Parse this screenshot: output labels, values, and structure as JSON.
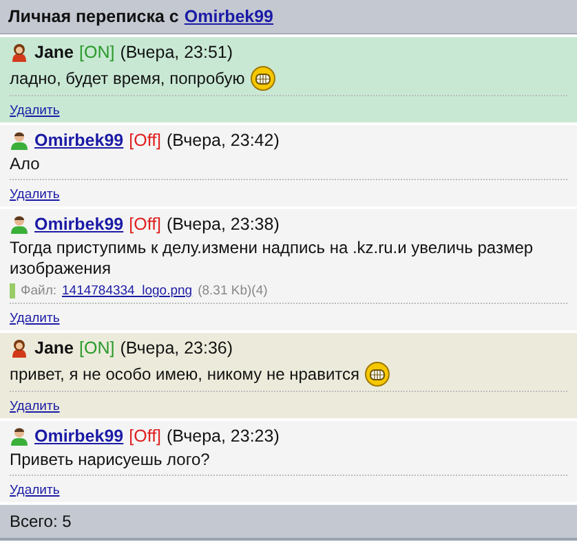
{
  "title": {
    "text": "Личная переписка с",
    "user": "Omirbek99"
  },
  "messages": [
    {
      "author": "Jane",
      "kind": "female",
      "linked": false,
      "online": true,
      "status": "[ON]",
      "time": "(Вчера, 23:51)",
      "text": "ладно, будет время, попробую",
      "smiley": true,
      "color": "#c8e8d4",
      "delete": "Удалить"
    },
    {
      "author": "Omirbek99",
      "kind": "male",
      "linked": true,
      "online": false,
      "status": "[Off]",
      "time": "(Вчера, 23:42)",
      "text": "Ало",
      "smiley": false,
      "color": "#f4f4f4",
      "delete": "Удалить"
    },
    {
      "author": "Omirbek99",
      "kind": "male",
      "linked": true,
      "online": false,
      "status": "[Off]",
      "time": "(Вчера, 23:38)",
      "text": "Тогда приступимь к делу.измени надпись на .kz.ru.и увеличь размер изображения",
      "smiley": false,
      "color": "#f4f4f4",
      "file": {
        "label": "Файл:",
        "name": "1414784334_logo.png",
        "info": "(8.31 Kb)(4)"
      },
      "delete": "Удалить"
    },
    {
      "author": "Jane",
      "kind": "female",
      "linked": false,
      "online": true,
      "status": "[ON]",
      "time": "(Вчера, 23:36)",
      "text": "привет, я не особо имею, никому не нравится",
      "smiley": true,
      "color": "#ecebdb",
      "delete": "Удалить"
    },
    {
      "author": "Omirbek99",
      "kind": "male",
      "linked": true,
      "online": false,
      "status": "[Off]",
      "time": "(Вчера, 23:23)",
      "text": "Приветь нарисуешь лого?",
      "smiley": false,
      "color": "#f4f4f4",
      "delete": "Удалить"
    }
  ],
  "footer": "Всего: 5"
}
